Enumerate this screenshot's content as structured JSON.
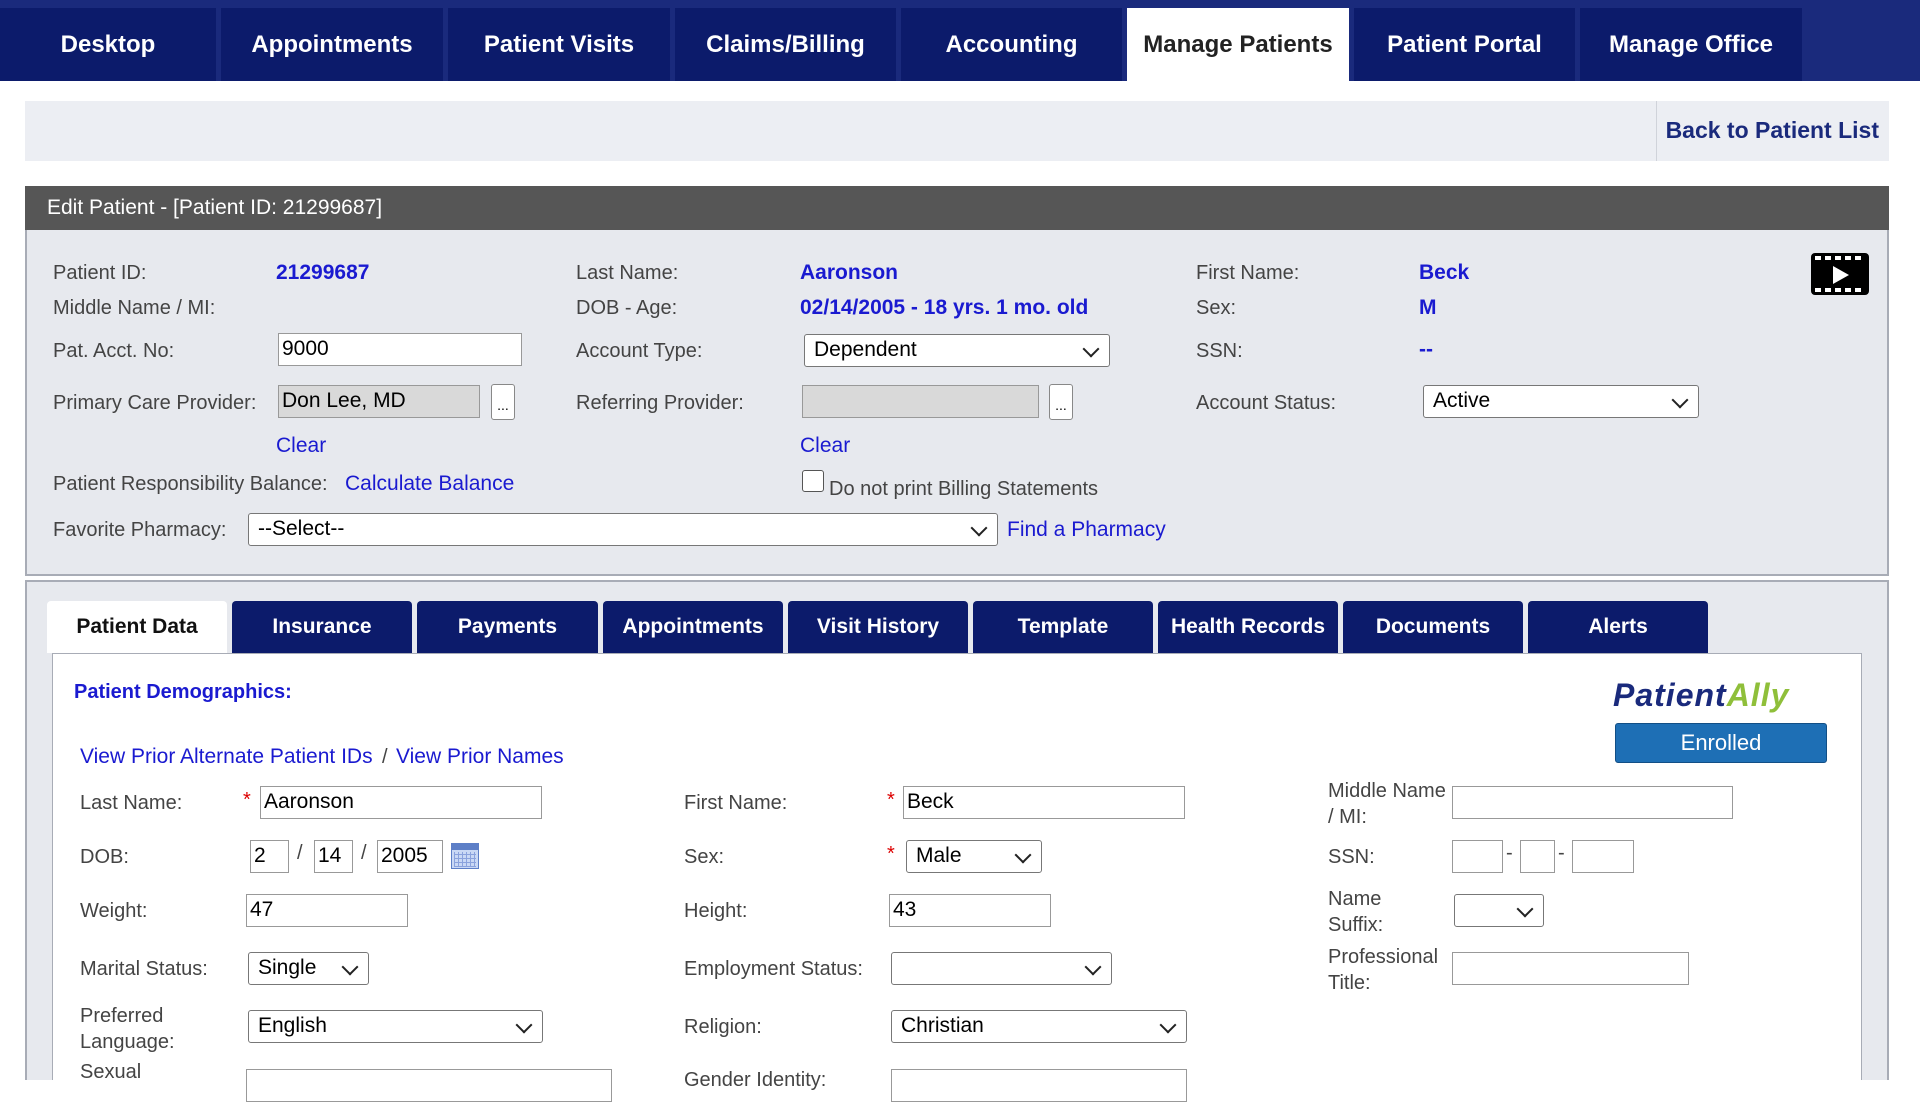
{
  "nav": {
    "tabs": [
      "Desktop",
      "Appointments",
      "Patient Visits",
      "Claims/Billing",
      "Accounting",
      "Manage Patients",
      "Patient Portal",
      "Manage Office"
    ],
    "active": "Manage Patients"
  },
  "back_link": "Back to Patient List",
  "edit_header": "Edit Patient - [Patient ID: 21299687]",
  "info": {
    "patient_id_label": "Patient ID:",
    "patient_id": "21299687",
    "last_name_label": "Last Name:",
    "last_name": "Aaronson",
    "first_name_label": "First Name:",
    "first_name": "Beck",
    "middle_label": "Middle Name / MI:",
    "dob_age_label": "DOB - Age:",
    "dob_age": "02/14/2005 - 18 yrs. 1 mo. old",
    "sex_label": "Sex:",
    "sex": "M",
    "acct_no_label": "Pat. Acct. No:",
    "acct_no": "9000",
    "account_type_label": "Account Type:",
    "account_type": "Dependent",
    "ssn_label": "SSN:",
    "ssn": "--",
    "pcp_label": "Primary Care Provider:",
    "pcp": "Don Lee, MD",
    "dots": "...",
    "referring_label": "Referring Provider:",
    "referring": "",
    "account_status_label": "Account Status:",
    "account_status": "Active",
    "clear": "Clear",
    "balance_label": "Patient Responsibility Balance:",
    "calculate_balance": "Calculate Balance",
    "no_print_label": "Do not print Billing Statements",
    "pharmacy_label": "Favorite Pharmacy:",
    "pharmacy": "--Select--",
    "find_pharmacy": "Find a Pharmacy",
    "video_icon": "video-play-icon"
  },
  "patient_tabs": [
    "Patient Data",
    "Insurance",
    "Payments",
    "Appointments",
    "Visit History",
    "Template",
    "Health Records",
    "Documents",
    "Alerts"
  ],
  "active_patient_tab": "Patient Data",
  "demographics": {
    "title": "Patient Demographics:",
    "view_prior_ids": "View Prior Alternate Patient IDs",
    "slash": "/",
    "view_prior_names": "View Prior Names",
    "logo_text_a": "Patient",
    "logo_text_b": "Ally",
    "enrolled": "Enrolled",
    "last_name_label": "Last Name:",
    "last_name": "Aaronson",
    "first_name_label": "First Name:",
    "first_name": "Beck",
    "middle_label": "Middle Name / MI:",
    "middle": "",
    "dob_label": "DOB:",
    "dob_month": "2",
    "dob_day": "14",
    "dob_year": "2005",
    "sex_label": "Sex:",
    "sex": "Male",
    "ssn_label": "SSN:",
    "weight_label": "Weight:",
    "weight": "47",
    "height_label": "Height:",
    "height": "43",
    "suffix_label": "Name Suffix:",
    "marital_label": "Marital Status:",
    "marital": "Single",
    "employment_label": "Employment Status:",
    "employment": "",
    "prof_title_label": "Professional Title:",
    "language_label": "Preferred Language:",
    "language": "English",
    "religion_label": "Religion:",
    "religion": "Christian",
    "sexual_label": "Sexual",
    "gender_label": "Gender Identity:",
    "required_mark": "*"
  },
  "colors": {
    "nav_bg": "#0c1b6b",
    "link": "#1a1ad0",
    "header_bg": "#565656",
    "panel_bg": "#e7e9ee",
    "enrolled_bg": "#1e6fb5"
  }
}
